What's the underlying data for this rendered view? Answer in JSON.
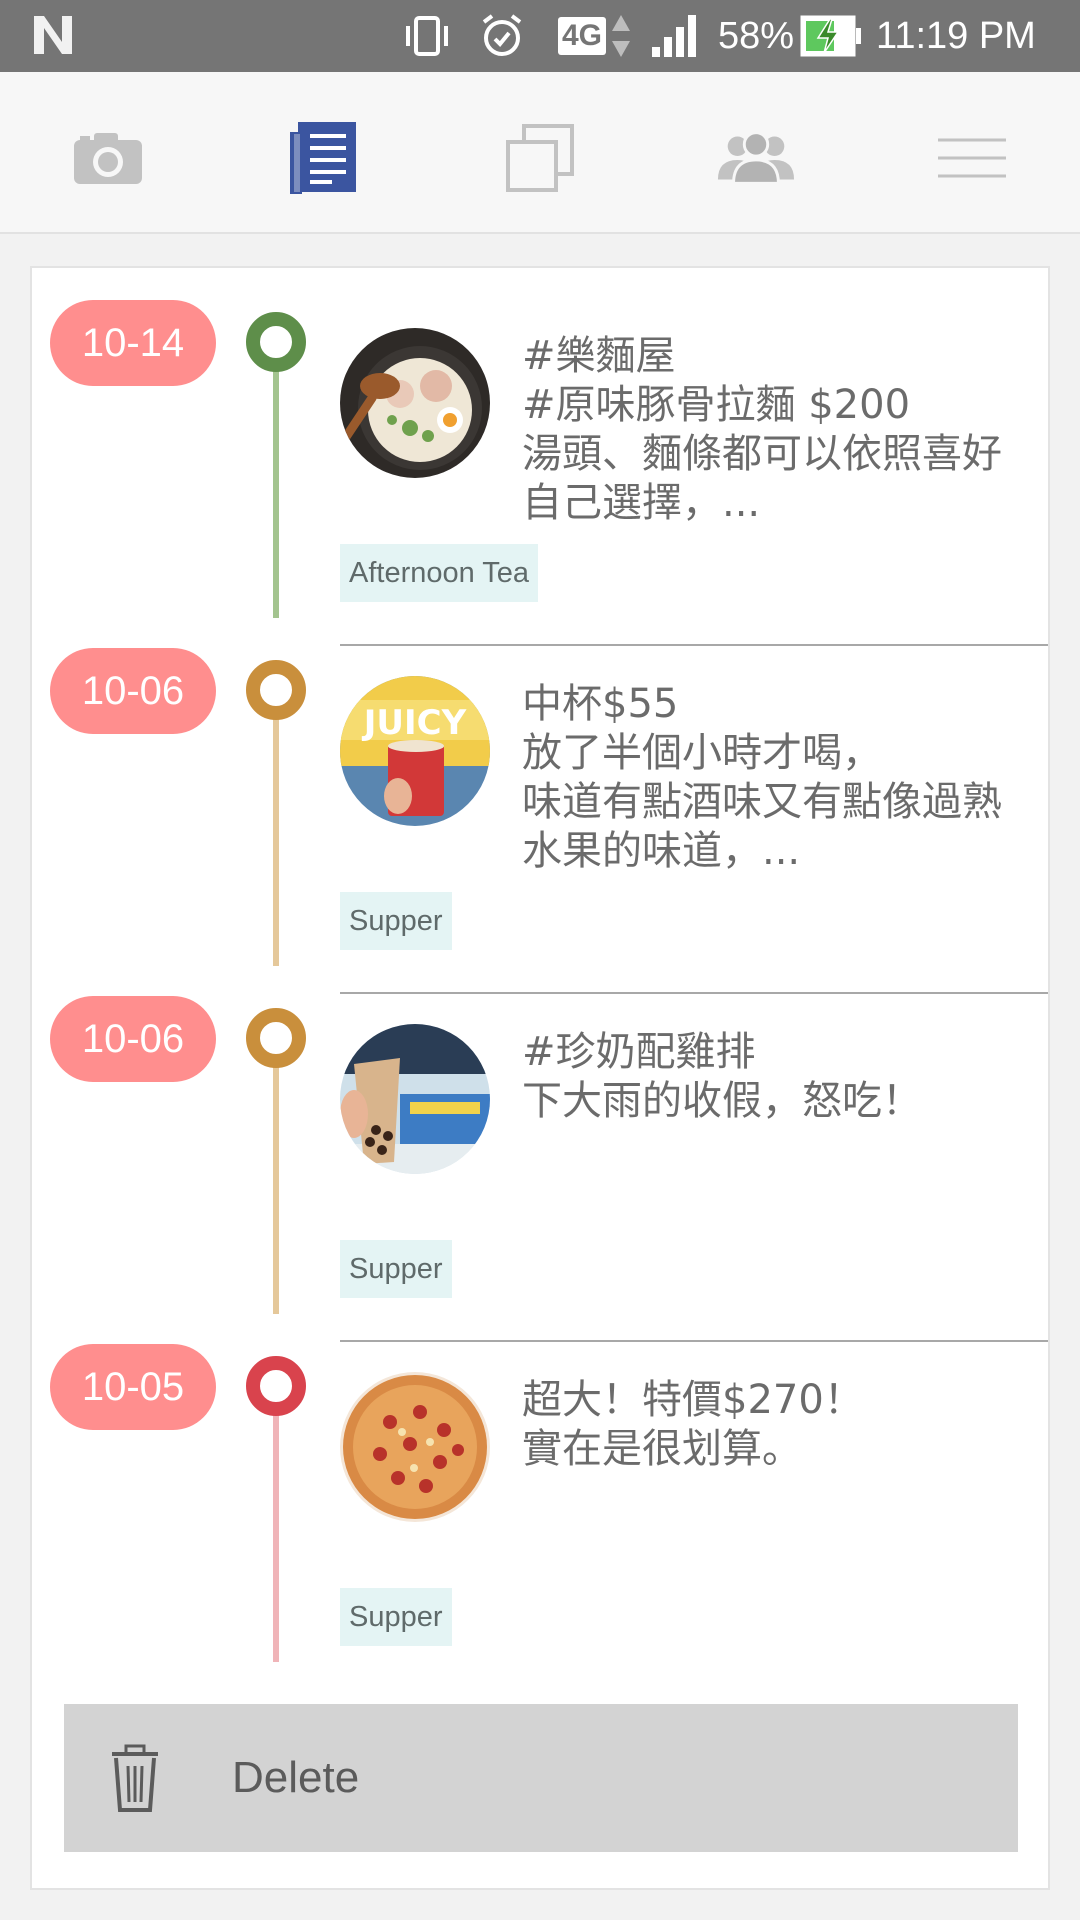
{
  "status_bar": {
    "network": "4G",
    "battery": "58%",
    "time": "11:19 PM",
    "icons": [
      "n-logo-icon",
      "vibrate-icon",
      "alarm-icon",
      "signal-icon",
      "battery-charging-icon"
    ]
  },
  "nav": {
    "tabs": [
      {
        "name": "camera-icon",
        "active": false
      },
      {
        "name": "journal-icon",
        "active": true
      },
      {
        "name": "gallery-icon",
        "active": false
      },
      {
        "name": "friends-icon",
        "active": false
      },
      {
        "name": "menu-icon",
        "active": false
      }
    ],
    "active_color": "#3b55a0",
    "inactive_color": "#c2c2c2"
  },
  "entries": [
    {
      "date": "10-14",
      "color": "#5e8e4a",
      "line_color": "#a3c48f",
      "lines": [
        "#樂麵屋",
        "#原味豚骨拉麵 $200",
        "湯頭、麵條都可以依照喜好",
        "自己選擇，..."
      ],
      "tag": "Afternoon Tea",
      "thumb": "ramen-photo"
    },
    {
      "date": "10-06",
      "color": "#c98f3c",
      "line_color": "#e5c89a",
      "lines": [
        "中杯$55",
        "放了半個小時才喝，",
        "味道有點酒味又有點像過熟",
        "水果的味道，..."
      ],
      "tag": "Supper",
      "thumb": "juicy-drink-photo"
    },
    {
      "date": "10-06",
      "color": "#c98f3c",
      "line_color": "#e5c89a",
      "lines": [
        "#珍奶配雞排",
        "下大雨的收假，怒吃！"
      ],
      "tag": "Supper",
      "thumb": "bubble-tea-photo"
    },
    {
      "date": "10-05",
      "color": "#d9434d",
      "line_color": "#f0b4b8",
      "lines": [
        "超大！特價$270！",
        "實在是很划算。"
      ],
      "tag": "Supper",
      "thumb": "pizza-photo"
    }
  ],
  "delete": {
    "label": "Delete",
    "icon": "trash-icon"
  }
}
